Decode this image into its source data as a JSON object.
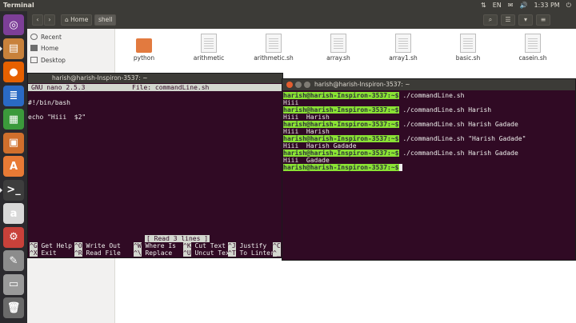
{
  "top_panel": {
    "title": "Terminal",
    "indicators": [
      "⇅",
      "EN",
      "✉",
      "🔊"
    ],
    "time": "1:33 PM",
    "power_icon": "power-icon"
  },
  "launcher": {
    "items": [
      {
        "name": "dash-icon",
        "glyph": "◎",
        "color": "#7d3f98"
      },
      {
        "name": "files-icon",
        "glyph": "▤",
        "color": "#c8813b"
      },
      {
        "name": "firefox-icon",
        "glyph": "●",
        "color": "#e66000"
      },
      {
        "name": "writer-icon",
        "glyph": "≣",
        "color": "#2a6ac4"
      },
      {
        "name": "calc-icon",
        "glyph": "▦",
        "color": "#3b9a3b"
      },
      {
        "name": "impress-icon",
        "glyph": "▣",
        "color": "#d06f2c"
      },
      {
        "name": "software-center-icon",
        "glyph": "A",
        "color": "#e87a35"
      },
      {
        "name": "terminal-icon",
        "glyph": ">_",
        "color": "#3d3d3d"
      },
      {
        "name": "amazon-icon",
        "glyph": "a",
        "color": "#d8d8d8"
      },
      {
        "name": "settings-icon",
        "glyph": "⚙",
        "color": "#c8413a"
      },
      {
        "name": "text-editor-icon",
        "glyph": "✎",
        "color": "#8c8c8c"
      },
      {
        "name": "drive-icon",
        "glyph": "▭",
        "color": "#9a9a9a"
      },
      {
        "name": "trash-icon",
        "glyph": "🗑",
        "color": "#6a6a6a"
      }
    ]
  },
  "files": {
    "breadcrumbs": [
      "Home",
      "shell"
    ],
    "sidebar": [
      "Recent",
      "Home",
      "Desktop"
    ],
    "items": [
      "python",
      "arithmetic",
      "arithmetic.sh",
      "array.sh",
      "array1.sh",
      "basic.sh",
      "casein.sh"
    ]
  },
  "nano": {
    "window_title": "harish@harish-Inspiron-3537: ~",
    "version": "GNU nano 2.5.3",
    "file_label": "File: commandLine.sh",
    "lines": [
      "#!/bin/bash",
      "",
      "echo \"Hiii  $2\""
    ],
    "status": "[ Read 3 lines ]",
    "shortcuts_row1": [
      {
        "key": "^G",
        "label": "Get Help"
      },
      {
        "key": "^O",
        "label": "Write Out"
      },
      {
        "key": "^W",
        "label": "Where Is"
      },
      {
        "key": "^K",
        "label": "Cut Text"
      },
      {
        "key": "^J",
        "label": "Justify"
      },
      {
        "key": "^C",
        "label": ""
      }
    ],
    "shortcuts_row2": [
      {
        "key": "^X",
        "label": "Exit"
      },
      {
        "key": "^R",
        "label": "Read File"
      },
      {
        "key": "^\\",
        "label": "Replace"
      },
      {
        "key": "^U",
        "label": "Uncut Text"
      },
      {
        "key": "^T",
        "label": "To Linter"
      },
      {
        "key": "^_",
        "label": ""
      }
    ]
  },
  "terminal": {
    "window_title": "harish@harish-Inspiron-3537: ~",
    "prompt": "harish@harish-Inspiron-3537:~$",
    "lines": [
      {
        "type": "cmd",
        "text": " ./commandLine.sh"
      },
      {
        "type": "out",
        "text": "Hiii"
      },
      {
        "type": "cmd",
        "text": " ./commandLine.sh Harish"
      },
      {
        "type": "out",
        "text": "Hiii  Harish"
      },
      {
        "type": "cmd",
        "text": " ./commandLine.sh Harish Gadade"
      },
      {
        "type": "out",
        "text": "Hiii  Harish"
      },
      {
        "type": "cmd",
        "text": " ./commandLine.sh \"Harish Gadade\""
      },
      {
        "type": "out",
        "text": "Hiii  Harish Gadade"
      },
      {
        "type": "cmd",
        "text": " ./commandLine.sh Harish Gadade"
      },
      {
        "type": "out",
        "text": "Hiii  Gadade"
      },
      {
        "type": "cmd",
        "text": ""
      }
    ]
  }
}
